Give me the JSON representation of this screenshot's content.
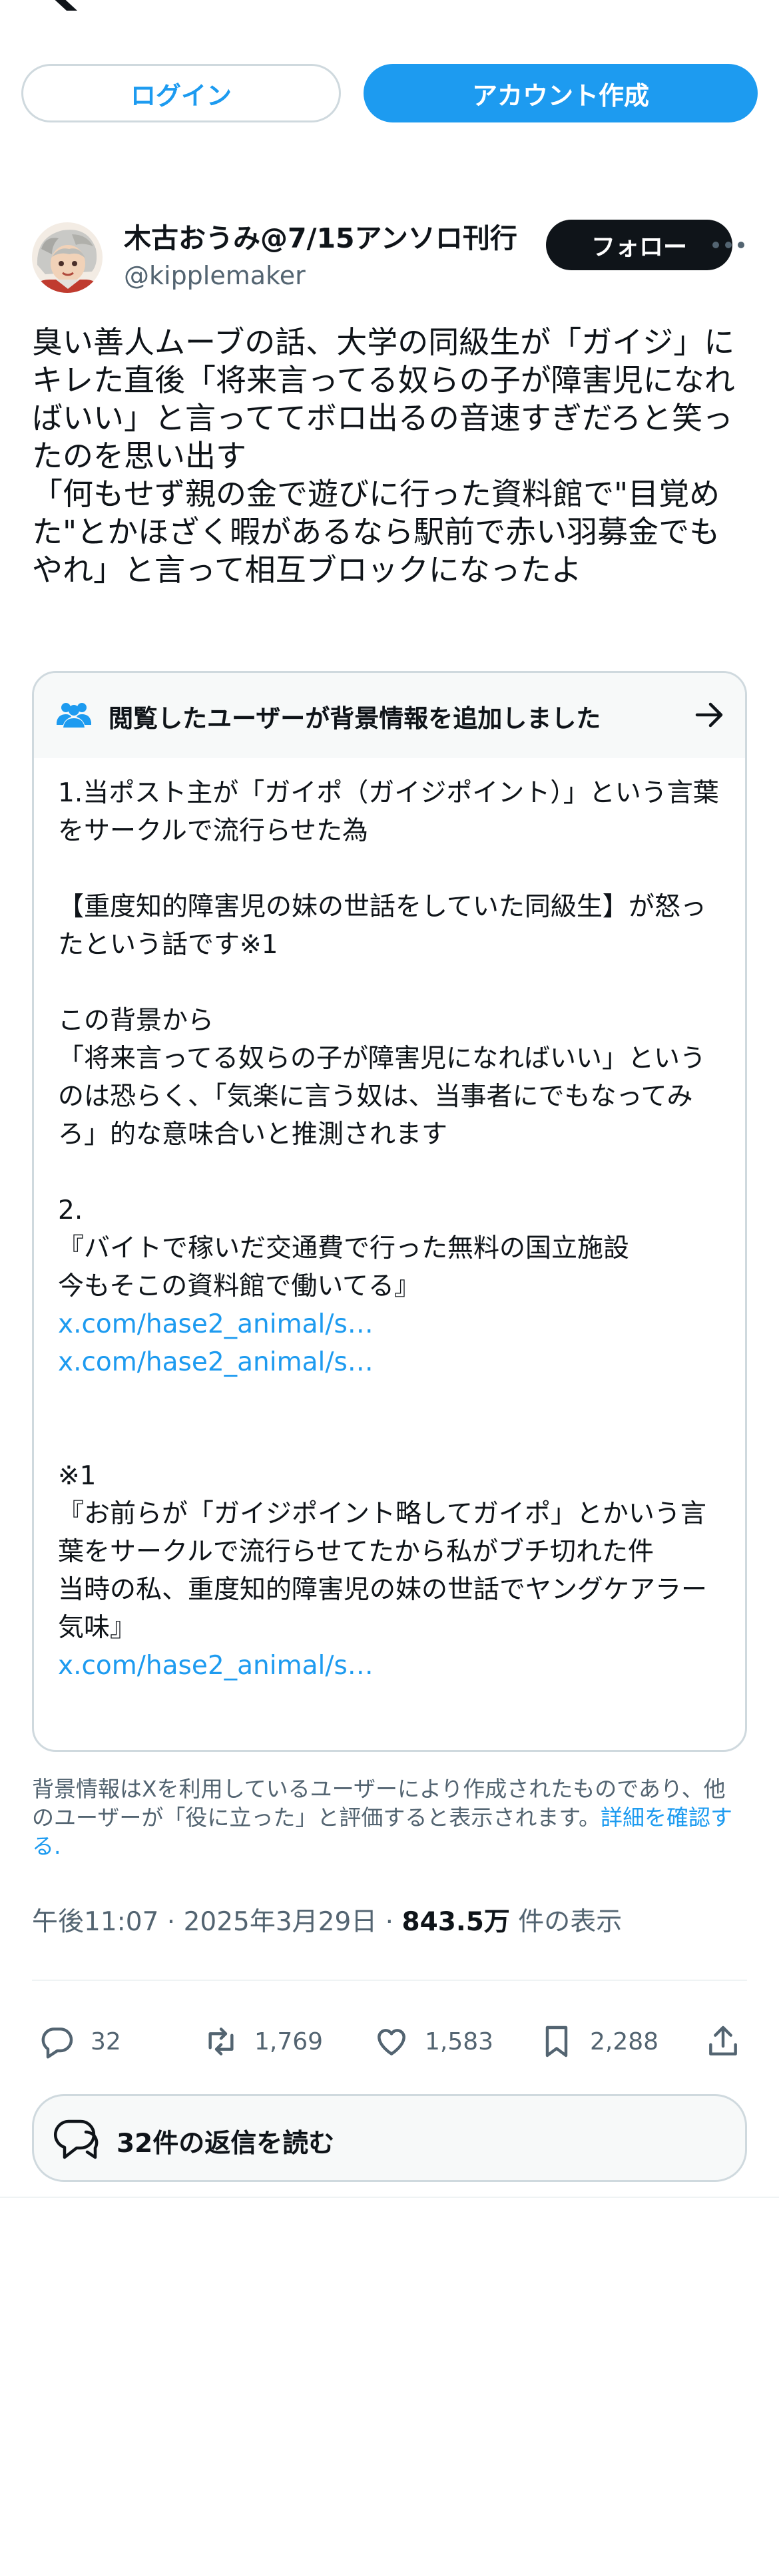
{
  "header": {
    "logo_icon": "x-logo-icon",
    "login_label": "ログイン",
    "signup_label": "アカウント作成"
  },
  "tweet": {
    "author_name": "木古おうみ@7/15アンソロ刊行",
    "author_handle": "@kipplemaker",
    "follow_label": "フォロー",
    "text": "臭い善人ムーブの話、大学の同級生が「ガイジ」にキレた直後「将来言ってる奴らの子が障害児になればいい」と言っててボロ出るの音速すぎだろと笑ったのを思い出す\n「何もせず親の金で遊びに行った資料館で\"目覚めた\"とかほざく暇があるなら駅前で赤い羽募金でもやれ」と言って相互ブロックになったよ",
    "note": {
      "title": "閲覧したユーザーが背景情報を追加しました",
      "p1": "1.当ポスト主が「ガイポ（ガイジポイント）」という言葉をサークルで流行らせた為",
      "p2": "【重度知的障害児の妹の世話をしていた同級生】が怒ったという話です※1",
      "p3": "この背景から\n「将来言ってる奴らの子が障害児になればいい」というのは恐らく、「気楽に言う奴は、当事者にでもなってみろ」的な意味合いと推測されます",
      "p4": "2.\n『バイトで稼いだ交通費で行った無料の国立施設\n今もそこの資料館で働いてる』",
      "link1": "x.com/hase2_animal/s…",
      "link2": "x.com/hase2_animal/s…",
      "p5": "※1\n『お前らが「ガイジポイント略してガイポ」とかいう言葉をサークルで流行らせてたから私がブチ切れた件\n当時の私、重度知的障害児の妹の世話でヤングケアラー気味』",
      "link3": "x.com/hase2_animal/s…"
    },
    "disclaimer": "背景情報はXを利用しているユーザーにより作成されたものであり、他のユーザーが「役に立った」と評価すると表示されます。",
    "disclaimer_link": "詳細を確認する",
    "disclaimer_period": ".",
    "time": "午後11:07 · 2025年3月29日 · ",
    "views": "843.5万",
    "views_suffix": " 件の表示",
    "counts": {
      "replies": "32",
      "reposts": "1,769",
      "likes": "1,583",
      "bookmarks": "2,288"
    },
    "read_replies_label": "32件の返信を読む"
  },
  "colors": {
    "accent": "#1d9bf0",
    "text": "#0f1419",
    "secondary": "#536471",
    "border": "#cfd9de"
  }
}
